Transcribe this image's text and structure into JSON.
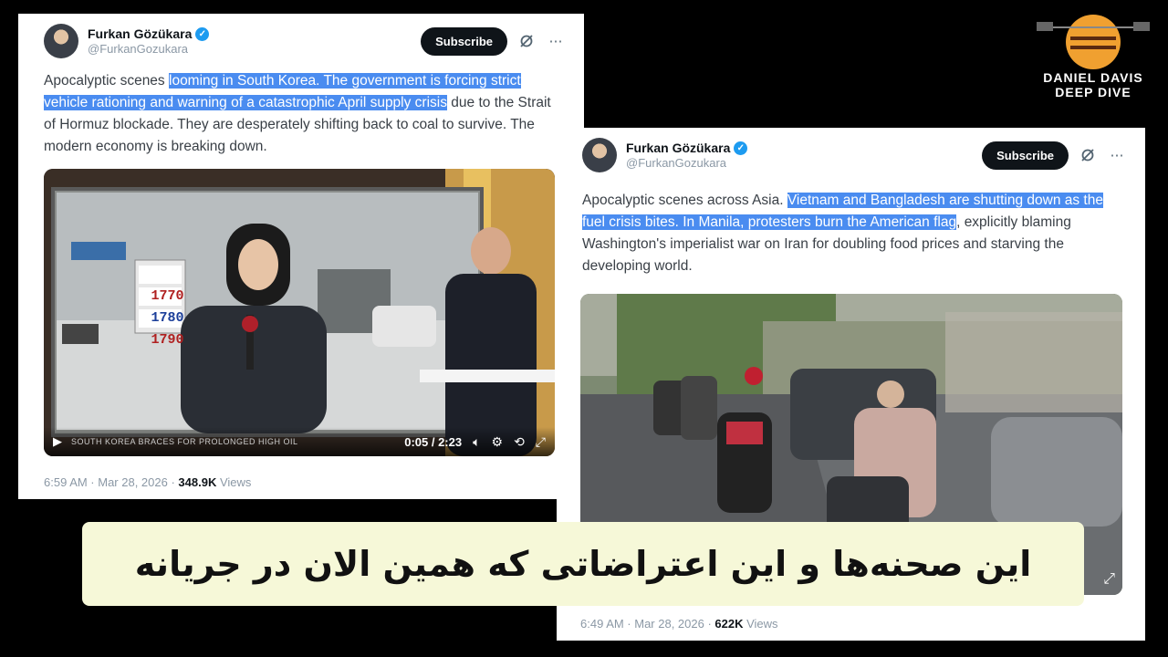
{
  "tweets": [
    {
      "author": "Furkan Gözükara",
      "handle": "@FurkanGozukara",
      "subscribe_label": "Subscribe",
      "text_plain_1": "Apocalyptic scenes ",
      "text_highlight": "looming in South Korea. The government is forcing strict vehicle rationing and warning of a catastrophic April supply crisis",
      "text_plain_2": " due to the Strait of Hormuz blockade. They are desperately shifting back to coal to survive. The modern economy is breaking down.",
      "time": "6:59 AM · Mar 28, 2026 · ",
      "views_count": "348.9K",
      "views_label": " Views",
      "video": {
        "time": "0:05 / 2:23",
        "ticker": "SOUTH KOREA BRACES FOR PROLONGED HIGH OIL",
        "prices": [
          "1770",
          "1780",
          "1790"
        ]
      }
    },
    {
      "author": "Furkan Gözükara",
      "handle": "@FurkanGozukara",
      "subscribe_label": "Subscribe",
      "text_plain_1": "Apocalyptic scenes across Asia. ",
      "text_highlight": "Vietnam and Bangladesh are shutting down as the fuel crisis bites. In Manila, protesters burn the American flag",
      "text_plain_2": ", explicitly blaming Washington's imperialist war on Iran for doubling food prices and starving the developing world.",
      "time": "6:49 AM · Mar 28, 2026 · ",
      "views_count": "622K",
      "views_label": " Views"
    }
  ],
  "logo": {
    "line1": "DANIEL DAVIS",
    "line2": "DEEP DIVE",
    "accent": "#f0a030"
  },
  "subtitle": "این صحنه‌ها و این اعتراضاتی که همین الان در جریانه",
  "colors": {
    "highlight": "#4a8cf0",
    "verified": "#1d9bf0",
    "subtitle_bg": "#f6f8d8"
  },
  "icons": [
    "verified-icon",
    "grok-icon",
    "more-icon",
    "play-icon",
    "volume-icon",
    "settings-icon",
    "loop-icon",
    "fullscreen-icon",
    "expand-icon"
  ]
}
